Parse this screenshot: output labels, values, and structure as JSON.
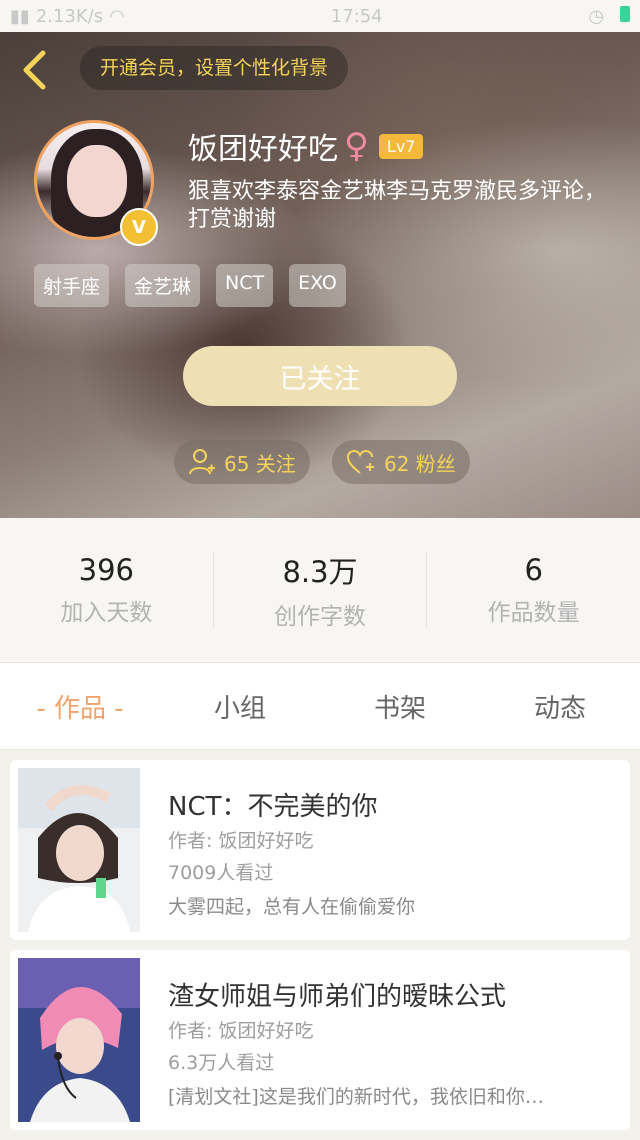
{
  "status": {
    "speed": "2.13K/s",
    "time": "17:54"
  },
  "header": {
    "vip_text": "开通会员，设置个性化背景"
  },
  "profile": {
    "username": "饭团好好吃",
    "gender_icon": "♀",
    "level": "Lv7",
    "bio": "狠喜欢李泰容金艺琳李马克罗澈民多评论，打赏谢谢",
    "tags": [
      "射手座",
      "金艺琳",
      "NCT",
      "EXO"
    ],
    "follow_label": "已关注",
    "following_count": "65 关注",
    "fans_count": "62 粉丝"
  },
  "stats": [
    {
      "value": "396",
      "label": "加入天数"
    },
    {
      "value": "8.3万",
      "label": "创作字数"
    },
    {
      "value": "6",
      "label": "作品数量"
    }
  ],
  "tabs": [
    {
      "label": "- 作品 -",
      "active": true
    },
    {
      "label": "小组",
      "active": false
    },
    {
      "label": "书架",
      "active": false
    },
    {
      "label": "动态",
      "active": false
    }
  ],
  "books": [
    {
      "title": "NCT：不完美的你",
      "author": "作者: 饭团好好吃",
      "views": "7009人看过",
      "desc": "大雾四起，总有人在偷偷爱你"
    },
    {
      "title": "渣女师姐与师弟们的暧昧公式",
      "author": "作者: 饭团好好吃",
      "views": "6.3万人看过",
      "desc": "[清划文社]这是我们的新时代，我依旧和你…"
    }
  ],
  "colors": {
    "accent_orange": "#f0a36b",
    "gold_text": "#f3d35a",
    "level_badge": "#f4b83a",
    "follow_button": "#efe0b4"
  }
}
